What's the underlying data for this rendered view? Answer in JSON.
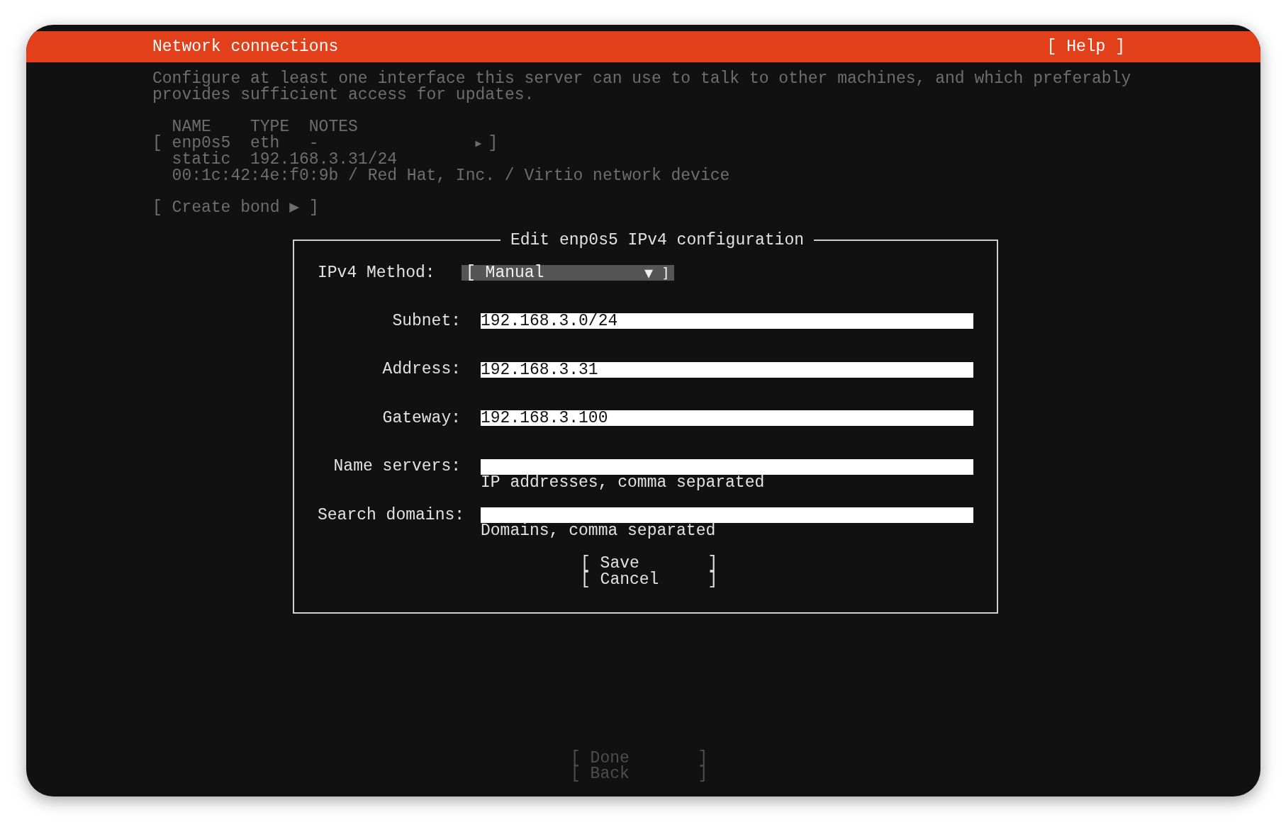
{
  "header": {
    "title": "Network connections",
    "help": "[ Help ]"
  },
  "description": "Configure at least one interface this server can use to talk to other machines, and which preferably provides sufficient access for updates.",
  "interfaces": {
    "columns": [
      "NAME",
      "TYPE",
      "NOTES"
    ],
    "rows": [
      {
        "open": "[",
        "name": "enp0s5",
        "type": "eth",
        "notes": "-",
        "arrow": "▶",
        "close": "]",
        "details": [
          "static  192.168.3.31/24",
          "00:1c:42:4e:f0:9b / Red Hat, Inc. / Virtio network device"
        ]
      }
    ]
  },
  "create_bond": "[ Create bond ▶ ]",
  "dialog": {
    "title": "Edit enp0s5 IPv4 configuration",
    "method": {
      "label": "IPv4 Method:",
      "open": "[",
      "value": "Manual",
      "caret": "▼",
      "close": "]"
    },
    "fields": [
      {
        "label": "Subnet:",
        "value": "192.168.3.0/24"
      },
      {
        "label": "Address:",
        "value": "192.168.3.31"
      },
      {
        "label": "Gateway:",
        "value": "192.168.3.100"
      },
      {
        "label": "Name servers:",
        "hint": "IP addresses, comma separated"
      },
      {
        "label": "Search domains:",
        "hint": "Domains, comma separated"
      }
    ],
    "buttons": [
      "[ Save       ]",
      "[ Cancel     ]"
    ]
  },
  "footer_buttons": [
    "[ Done       ]",
    "[ Back       ]"
  ]
}
